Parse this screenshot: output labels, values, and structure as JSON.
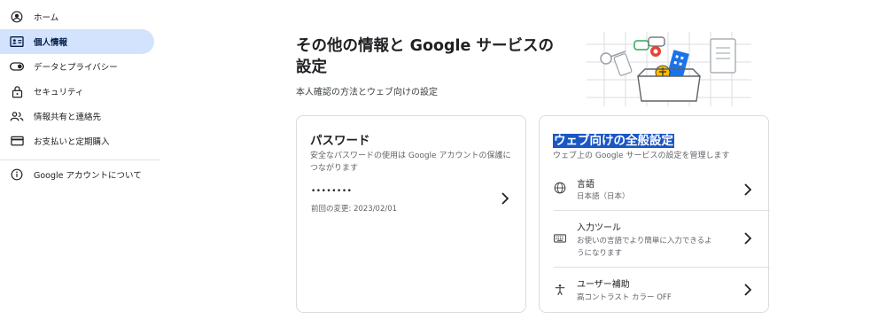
{
  "sidebar": {
    "items": [
      {
        "label": "ホーム",
        "icon": "account-circle-icon"
      },
      {
        "label": "個人情報",
        "icon": "id-card-icon"
      },
      {
        "label": "データとプライバシー",
        "icon": "toggle-icon"
      },
      {
        "label": "セキュリティ",
        "icon": "lock-icon"
      },
      {
        "label": "情報共有と連絡先",
        "icon": "people-icon"
      },
      {
        "label": "お支払いと定期購入",
        "icon": "credit-card-icon"
      },
      {
        "label": "Google アカウントについて",
        "icon": "info-icon"
      }
    ],
    "active_index": 1
  },
  "main": {
    "title": "その他の情報と Google サービスの設定",
    "subtitle": "本人確認の方法とウェブ向けの設定"
  },
  "password_card": {
    "title": "パスワード",
    "description": "安全なパスワードの使用は Google アカウントの保護につながります",
    "masked": "••••••••",
    "last_changed": "前回の変更: 2023/02/01"
  },
  "web_card": {
    "title": "ウェブ向けの全般設定",
    "description": "ウェブ上の Google サービスの設定を管理します",
    "rows": [
      {
        "label": "言語",
        "value": "日本語（日本）",
        "icon": "globe-icon"
      },
      {
        "label": "入力ツール",
        "value": "お使いの言語でより簡単に入力できるようになります",
        "icon": "keyboard-icon"
      },
      {
        "label": "ユーザー補助",
        "value": "高コントラスト カラー OFF",
        "icon": "accessibility-icon"
      }
    ]
  },
  "colors": {
    "active_nav": "#d3e3fd",
    "highlight": "#1a56c4",
    "border": "#dadce0"
  }
}
